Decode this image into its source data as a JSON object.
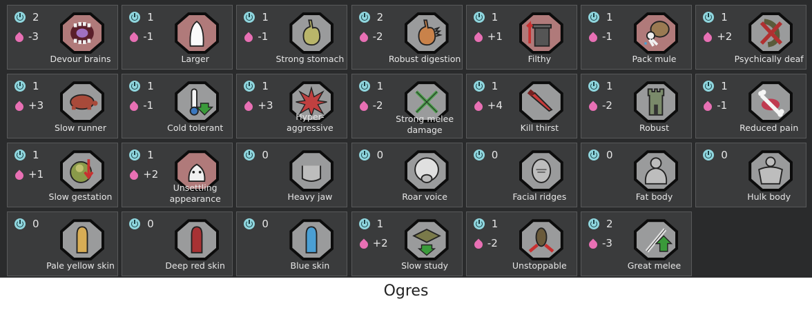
{
  "caption": "Ogres",
  "genes": [
    {
      "label": "Devour brains",
      "complexity": "2",
      "metabolism": "-3",
      "icon": "mouth-brains-icon",
      "bg": "red"
    },
    {
      "label": "Larger",
      "complexity": "1",
      "metabolism": "-1",
      "icon": "larger-body-icon",
      "bg": "red"
    },
    {
      "label": "Strong stomach",
      "complexity": "1",
      "metabolism": "-1",
      "icon": "stomach-icon",
      "bg": "grey"
    },
    {
      "label": "Robust digestion",
      "complexity": "2",
      "metabolism": "-2",
      "icon": "robust-stomach-icon",
      "bg": "grey"
    },
    {
      "label": "Filthy",
      "complexity": "1",
      "metabolism": "+1",
      "icon": "trash-can-icon",
      "bg": "red"
    },
    {
      "label": "Pack mule",
      "complexity": "1",
      "metabolism": "-1",
      "icon": "pack-mule-icon",
      "bg": "red"
    },
    {
      "label": "Psychically deaf",
      "complexity": "1",
      "metabolism": "+2",
      "icon": "psychic-deaf-icon",
      "bg": "grey"
    },
    {
      "label": "Slow runner",
      "complexity": "1",
      "metabolism": "+3",
      "icon": "turtle-icon",
      "bg": "grey"
    },
    {
      "label": "Cold tolerant",
      "complexity": "1",
      "metabolism": "-1",
      "icon": "thermometer-cold-icon",
      "bg": "grey"
    },
    {
      "label": "Hyper-aggressive",
      "complexity": "1",
      "metabolism": "+3",
      "icon": "aggression-burst-icon",
      "bg": "grey"
    },
    {
      "label": "Strong melee damage",
      "complexity": "1",
      "metabolism": "-2",
      "icon": "crossed-swords-icon",
      "bg": "grey"
    },
    {
      "label": "Kill thirst",
      "complexity": "1",
      "metabolism": "+4",
      "icon": "bloody-knife-icon",
      "bg": "grey"
    },
    {
      "label": "Robust",
      "complexity": "1",
      "metabolism": "-2",
      "icon": "castle-tower-icon",
      "bg": "grey"
    },
    {
      "label": "Reduced pain",
      "complexity": "1",
      "metabolism": "-1",
      "icon": "bone-icon",
      "bg": "grey"
    },
    {
      "label": "Slow gestation",
      "complexity": "1",
      "metabolism": "+1",
      "icon": "fetus-icon",
      "bg": "grey"
    },
    {
      "label": "Unsettling appearance",
      "complexity": "1",
      "metabolism": "+2",
      "icon": "unsettling-face-icon",
      "bg": "red"
    },
    {
      "label": "Heavy jaw",
      "complexity": "0",
      "metabolism": "",
      "icon": "jaw-icon",
      "bg": "grey"
    },
    {
      "label": "Roar voice",
      "complexity": "0",
      "metabolism": "",
      "icon": "roar-voice-icon",
      "bg": "grey"
    },
    {
      "label": "Facial ridges",
      "complexity": "0",
      "metabolism": "",
      "icon": "facial-ridges-icon",
      "bg": "grey"
    },
    {
      "label": "Fat body",
      "complexity": "0",
      "metabolism": "",
      "icon": "fat-body-icon",
      "bg": "grey"
    },
    {
      "label": "Hulk body",
      "complexity": "0",
      "metabolism": "",
      "icon": "hulk-body-icon",
      "bg": "grey"
    },
    {
      "label": "Pale yellow skin",
      "complexity": "0",
      "metabolism": "",
      "icon": "skin-pale-yellow-icon",
      "bg": "grey",
      "color": "#d8ad55"
    },
    {
      "label": "Deep red skin",
      "complexity": "0",
      "metabolism": "",
      "icon": "skin-deep-red-icon",
      "bg": "grey",
      "color": "#a83234"
    },
    {
      "label": "Blue skin",
      "complexity": "0",
      "metabolism": "",
      "icon": "skin-blue-icon",
      "bg": "grey",
      "color": "#4a9fd4"
    },
    {
      "label": "Slow study",
      "complexity": "1",
      "metabolism": "+2",
      "icon": "graduation-cap-icon",
      "bg": "grey"
    },
    {
      "label": "Unstoppable",
      "complexity": "1",
      "metabolism": "-2",
      "icon": "unstoppable-icon",
      "bg": "grey"
    },
    {
      "label": "Great melee",
      "complexity": "2",
      "metabolism": "-3",
      "icon": "great-sword-icon",
      "bg": "grey"
    }
  ]
}
